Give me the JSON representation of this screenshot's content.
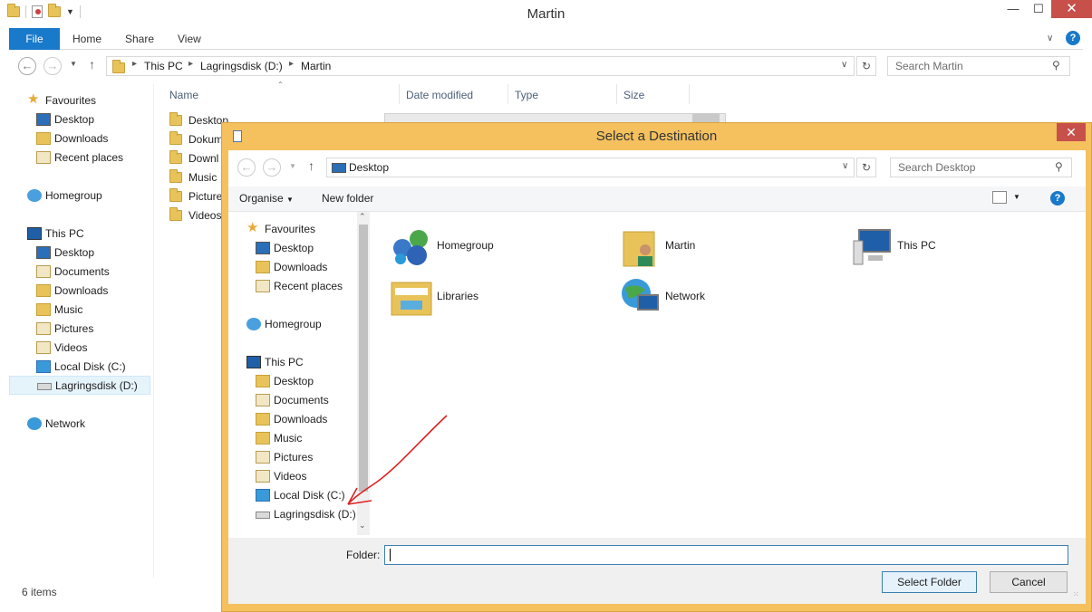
{
  "explorer": {
    "title": "Martin",
    "ribbon_tabs": [
      "File",
      "Home",
      "Share",
      "View"
    ],
    "breadcrumb": [
      "This PC",
      "Lagringsdisk (D:)",
      "Martin"
    ],
    "search_placeholder": "Search Martin",
    "nav": {
      "favourites": "Favourites",
      "fav_items": [
        "Desktop",
        "Downloads",
        "Recent places"
      ],
      "homegroup": "Homegroup",
      "this_pc": "This PC",
      "pc_items": [
        "Desktop",
        "Documents",
        "Downloads",
        "Music",
        "Pictures",
        "Videos",
        "Local Disk (C:)",
        "Lagringsdisk (D:)"
      ],
      "network": "Network"
    },
    "columns": [
      "Name",
      "Date modified",
      "Type",
      "Size"
    ],
    "files": [
      "Desktop",
      "Dokum",
      "Downl",
      "Music",
      "Picture",
      "Videos"
    ],
    "status": "6 items"
  },
  "dialog": {
    "title": "Select a Destination",
    "address": "Desktop",
    "search_placeholder": "Search Desktop",
    "organise": "Organise",
    "new_folder": "New folder",
    "nav": {
      "favourites": "Favourites",
      "fav_items": [
        "Desktop",
        "Downloads",
        "Recent places"
      ],
      "homegroup": "Homegroup",
      "this_pc": "This PC",
      "pc_items": [
        "Desktop",
        "Documents",
        "Downloads",
        "Music",
        "Pictures",
        "Videos",
        "Local Disk (C:)",
        "Lagringsdisk (D:)"
      ]
    },
    "items": [
      "Homegroup",
      "Martin",
      "This PC",
      "Libraries",
      "Network"
    ],
    "folder_label": "Folder:",
    "folder_value": "",
    "select_button": "Select Folder",
    "cancel_button": "Cancel"
  },
  "colors": {
    "accent": "#1979ca",
    "dialog_frame": "#f4c15e",
    "close": "#c7504b",
    "annotation": "#e02020"
  }
}
